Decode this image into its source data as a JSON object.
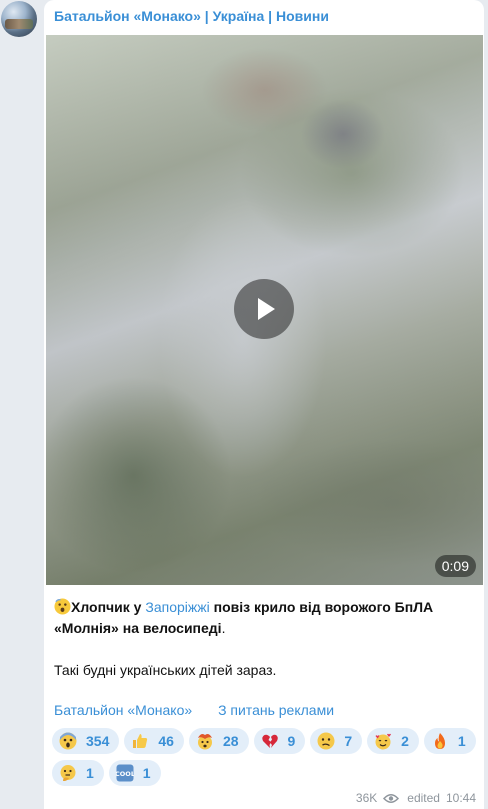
{
  "channel": {
    "name": "Батальйон «Монако» | Україна | Новини"
  },
  "video": {
    "duration": "0:09"
  },
  "message": {
    "bold_text": "Хлопчик у",
    "link_city": "Запоріжжі",
    "bold_text_2": "повіз крило від ворожого БпЛА «Молнія» на велосипеді",
    "period": ".",
    "paragraph2": "Такі будні українських дітей зараз."
  },
  "links": {
    "link1": "Батальйон «Монако»",
    "link2": "З питань реклами"
  },
  "reactions": [
    {
      "emoji": "scream-emoji",
      "count": "354"
    },
    {
      "emoji": "thumbs-up-emoji",
      "count": "46"
    },
    {
      "emoji": "exploding-head-emoji",
      "count": "28"
    },
    {
      "emoji": "broken-heart-emoji",
      "count": "9"
    },
    {
      "emoji": "confused-face-emoji",
      "count": "7"
    },
    {
      "emoji": "smiling-hearts-emoji",
      "count": "2"
    },
    {
      "emoji": "fire-emoji",
      "count": "1"
    },
    {
      "emoji": "thinking-face-emoji",
      "count": "1"
    },
    {
      "emoji": "cool-button-emoji",
      "count": "1"
    }
  ],
  "meta": {
    "views": "36K",
    "edited": "edited",
    "time": "10:44"
  },
  "colors": {
    "accent": "#3a8fd6",
    "reaction_bg": "#e3eef9"
  }
}
